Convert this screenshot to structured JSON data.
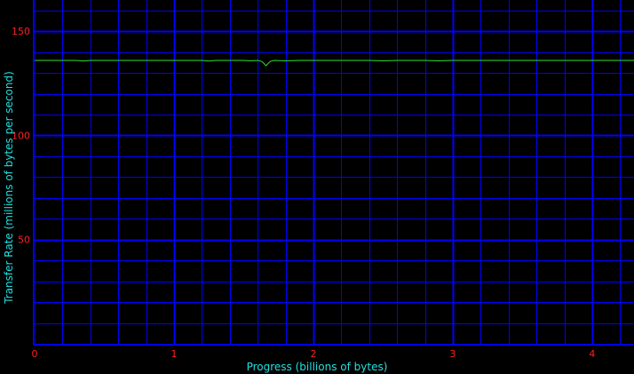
{
  "chart_data": {
    "type": "line",
    "xlabel": "Progress (billions of bytes)",
    "ylabel": "Transfer Rate (millions of bytes per second)",
    "xlim": [
      0,
      4.3
    ],
    "ylim": [
      0,
      165
    ],
    "x_ticks": [
      0,
      1,
      2,
      3,
      4
    ],
    "y_ticks": [
      50,
      100,
      150
    ],
    "grid": true,
    "colors": {
      "background": "#000000",
      "grid": "#0000ff",
      "tick_labels": "#ff2020",
      "axis_titles": "#20e0e0",
      "series": "#30e030"
    },
    "series": [
      {
        "x": [
          0,
          0.1,
          0.2,
          0.3,
          0.35,
          0.4,
          0.5,
          0.6,
          0.7,
          0.8,
          0.9,
          1.0,
          1.1,
          1.2,
          1.25,
          1.3,
          1.4,
          1.5,
          1.55,
          1.6,
          1.63,
          1.66,
          1.69,
          1.72,
          1.8,
          1.9,
          2.0,
          2.1,
          2.2,
          2.3,
          2.4,
          2.5,
          2.6,
          2.7,
          2.8,
          2.9,
          3.0,
          3.1,
          3.2,
          3.3,
          3.4,
          3.5,
          3.6,
          3.7,
          3.8,
          3.9,
          4.0,
          4.1,
          4.2,
          4.3
        ],
        "y": [
          136,
          136,
          136,
          136,
          135.7,
          136,
          136,
          136,
          136,
          136,
          136,
          136,
          136,
          136,
          135.7,
          136,
          136,
          136,
          135.8,
          136,
          135.5,
          133.5,
          135.5,
          136,
          135.8,
          136,
          136,
          136,
          136,
          136,
          136,
          135.8,
          136,
          136,
          136,
          135.8,
          136,
          136,
          136,
          136,
          136,
          136,
          136,
          136,
          136,
          136,
          136,
          136,
          136,
          136
        ]
      }
    ]
  }
}
